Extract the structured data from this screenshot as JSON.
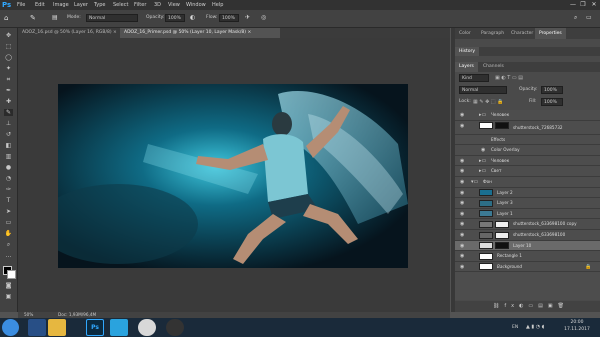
{
  "menubar": {
    "logo": "Ps",
    "items": [
      "File",
      "Edit",
      "Image",
      "Layer",
      "Type",
      "Select",
      "Filter",
      "3D",
      "View",
      "Window",
      "Help"
    ],
    "controls": [
      "—",
      "❐",
      "✕"
    ]
  },
  "options": {
    "mode_label": "Mode:",
    "mode_value": "Normal",
    "opacity_label": "Opacity:",
    "opacity_value": "100%",
    "flow_label": "Flow:",
    "flow_value": "100%"
  },
  "tabs": [
    {
      "label": "ADOZ_16.psd @ 50% (Layer 16, RGB/8)",
      "close": "×"
    },
    {
      "label": "ADOZ_16_Primer.psd @ 50% (Layer 10, Layer Mask/8)",
      "close": "×"
    }
  ],
  "panel_tabs_top": [
    "Color",
    "Paragraph",
    "Character",
    "Properties"
  ],
  "panel_history_tab": "History",
  "panel_layers_tabs": [
    "Layers",
    "Channels"
  ],
  "layers_controls": {
    "kind": "Kind",
    "blend": "Normal",
    "opacity_label": "Opacity:",
    "opacity_value": "100%",
    "lock_label": "Lock:",
    "fill_label": "Fill:",
    "fill_value": "100%"
  },
  "layers": [
    {
      "name": "Человек",
      "type": "group"
    },
    {
      "name": "shutterstock_72685732",
      "type": "smart"
    },
    {
      "name": "Effects",
      "type": "effect"
    },
    {
      "name": "Color Overlay",
      "type": "effect"
    },
    {
      "name": "Человек",
      "type": "group"
    },
    {
      "name": "Свет",
      "type": "group"
    },
    {
      "name": "Фон",
      "type": "group"
    },
    {
      "name": "Layer 2",
      "type": "layer"
    },
    {
      "name": "Layer 3",
      "type": "layer"
    },
    {
      "name": "Layer 1",
      "type": "layer"
    },
    {
      "name": "shutterstock_633698100 copy",
      "type": "layer"
    },
    {
      "name": "shutterstock_633698100",
      "type": "layer"
    },
    {
      "name": "Layer 10",
      "type": "layer",
      "selected": true
    },
    {
      "name": "Rectangle 1",
      "type": "layer"
    },
    {
      "name": "Background",
      "type": "background"
    }
  ],
  "status": {
    "zoom": "50%",
    "doc": "Doc: 1,93M/96,4M"
  },
  "taskbar": {
    "time": "20:00",
    "date": "17.11.2017",
    "lang": "EN"
  }
}
